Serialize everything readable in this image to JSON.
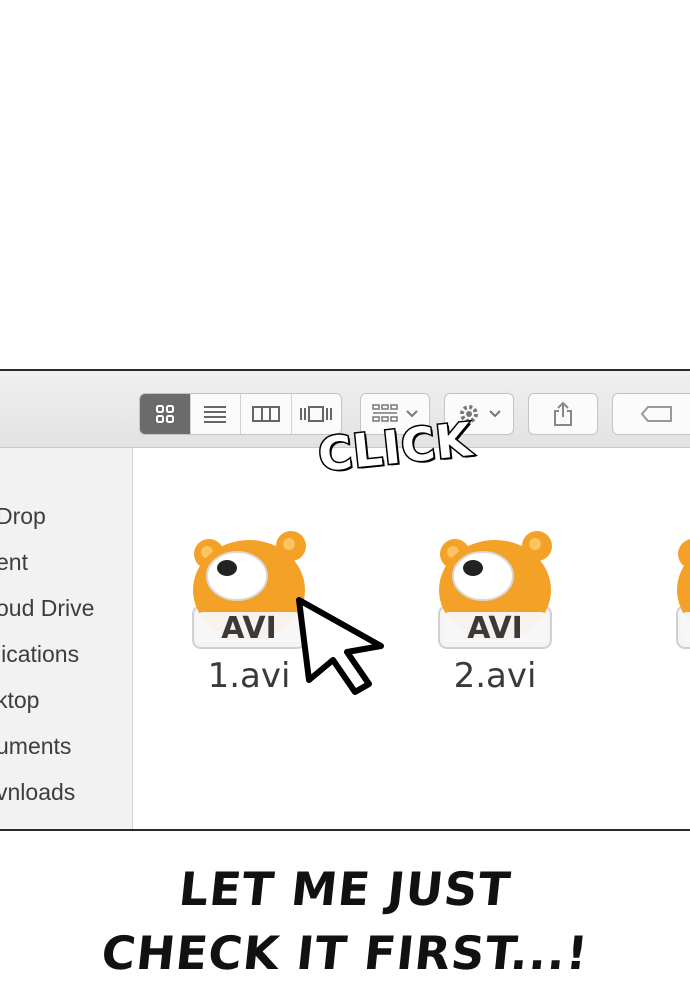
{
  "sidebar": {
    "items": [
      {
        "label": "Drop"
      },
      {
        "label": "ent"
      },
      {
        "label": "oud Drive"
      },
      {
        "label": "lications"
      },
      {
        "label": "ktop"
      },
      {
        "label": "uments"
      },
      {
        "label": "vnloads"
      }
    ]
  },
  "toolbar": {
    "view_buttons": [
      "icon-view-icon",
      "list-view-icon",
      "column-view-icon",
      "cover-flow-icon"
    ],
    "active_view": "icon-view-icon"
  },
  "files": [
    {
      "name": "1.avi",
      "badge": "AVI"
    },
    {
      "name": "2.avi",
      "badge": "AVI"
    },
    {
      "name": "",
      "badge": ""
    }
  ],
  "sound_effect": "CLICK",
  "caption": {
    "line1": "LET ME JUST",
    "line2": "CHECK IT FIRST...!"
  },
  "colors": {
    "icon_orange": "#f3a227",
    "active_view_bg": "#6b6b6b",
    "border": "#2a2a2a"
  }
}
